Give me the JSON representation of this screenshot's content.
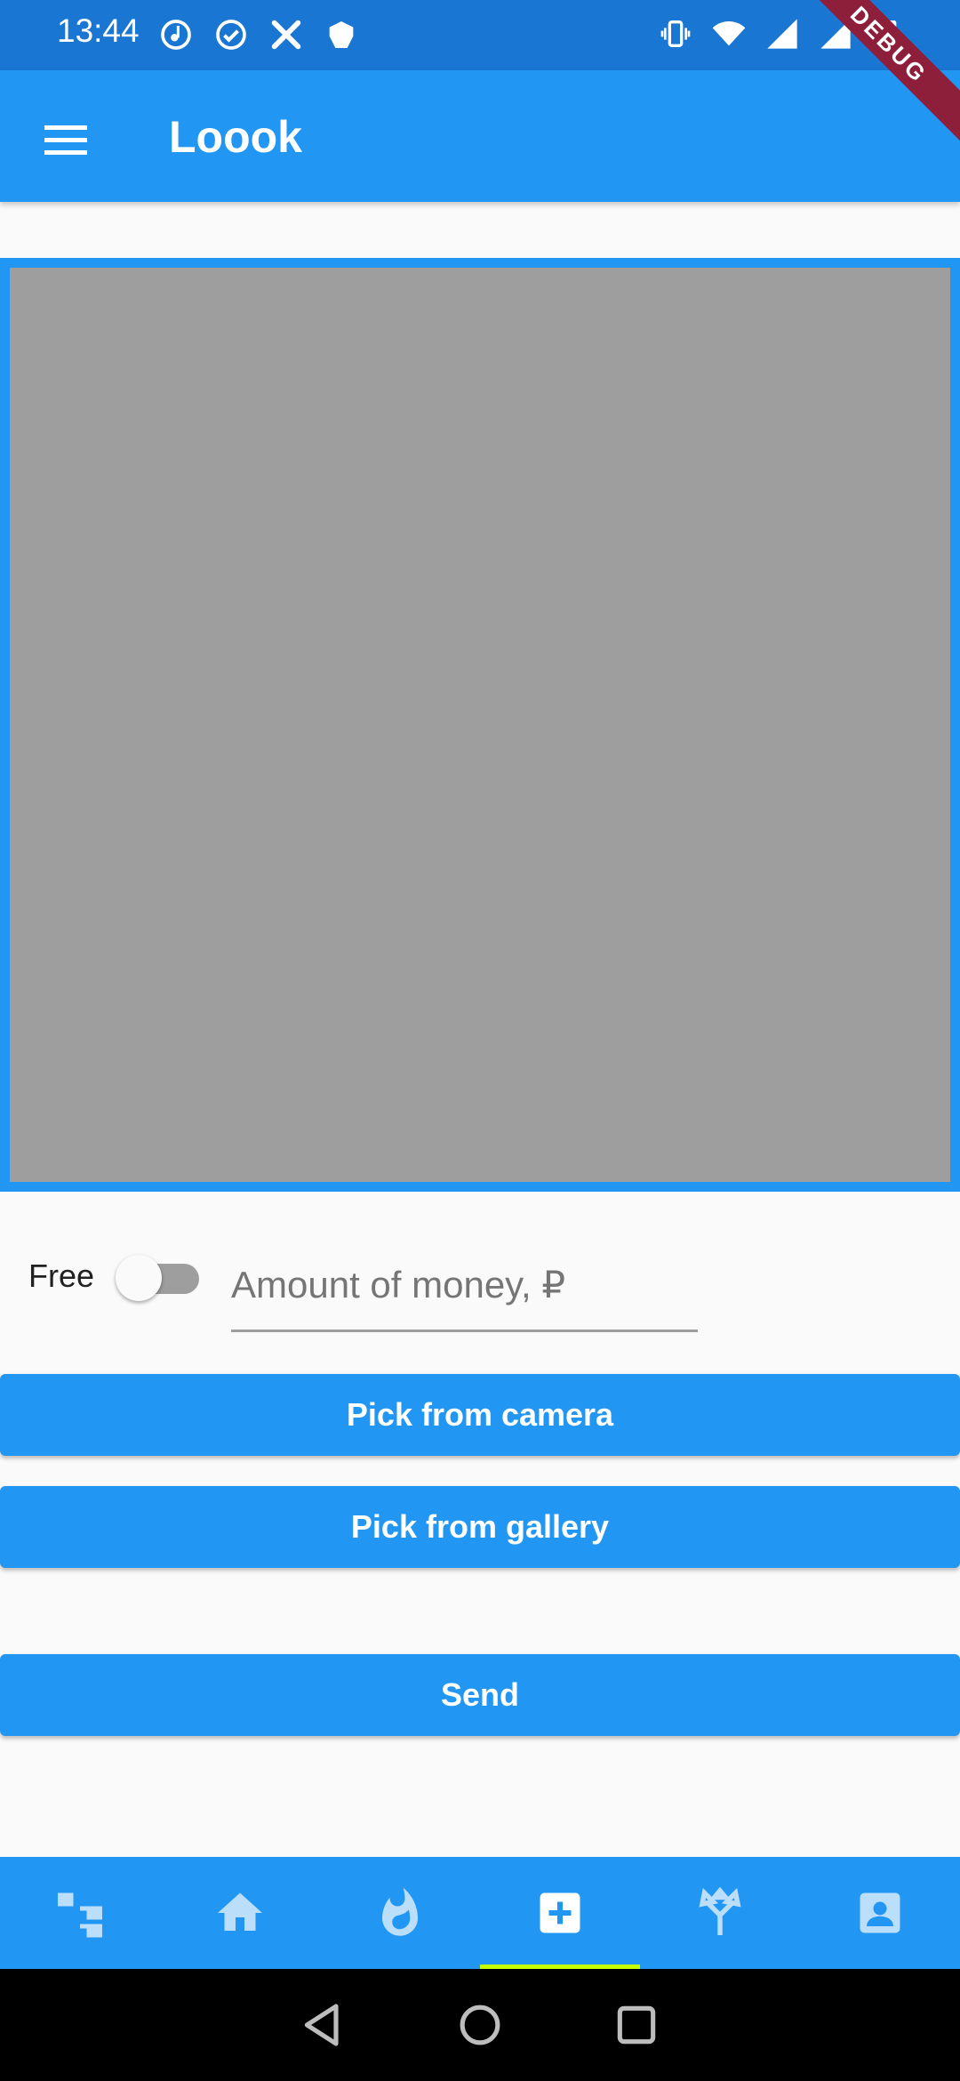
{
  "status_bar": {
    "time": "13:44"
  },
  "app_bar": {
    "title": "Loook",
    "debug_banner": "DEBUG"
  },
  "form": {
    "free_label": "Free",
    "free_toggle_on": false,
    "amount_placeholder": "Amount of money, ₽",
    "amount_value": ""
  },
  "buttons": {
    "camera_label": "Pick from camera",
    "gallery_label": "Pick from gallery",
    "send_label": "Send"
  },
  "bottom_nav": {
    "active_index": 3,
    "items": [
      {
        "icon": "tree-structure-icon"
      },
      {
        "icon": "home-icon"
      },
      {
        "icon": "fire-icon"
      },
      {
        "icon": "add-box-icon"
      },
      {
        "icon": "merge-icon"
      },
      {
        "icon": "contact-card-icon"
      }
    ]
  },
  "colors": {
    "primary": "#2196f3",
    "status_bar": "#1976d2",
    "active_indicator": "#c6ff00",
    "placeholder_gray": "#9e9e9e",
    "debug_banner": "#8e1f3b"
  }
}
